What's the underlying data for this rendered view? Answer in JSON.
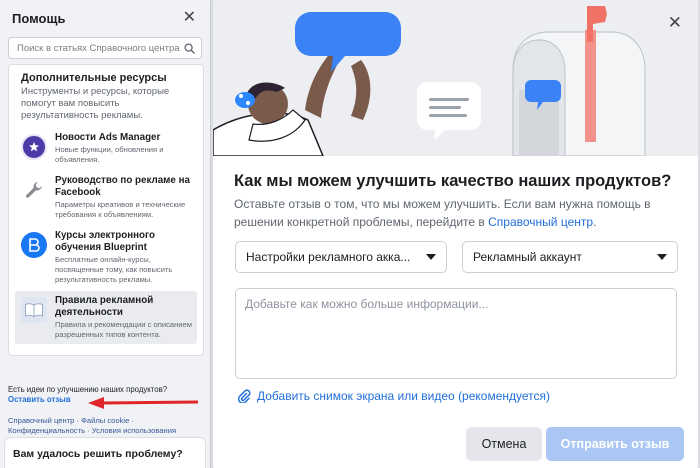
{
  "help": {
    "title": "Помощь",
    "close_icon": "close-icon",
    "search_placeholder": "Поиск в статьях Справочного центра",
    "resources_title": "Дополнительные ресурсы",
    "resources_subtitle": "Инструменты и ресурсы, которые помогут вам повысить результативность рекламы.",
    "items": [
      {
        "name": "Новости Ads Manager",
        "desc": "Новые функции, обновления и объявления.",
        "icon": "star-badge-icon",
        "color": "#4b3ba7"
      },
      {
        "name": "Руководство по рекламе на Facebook",
        "desc": "Параметры креативов и технические требования к объявлениям.",
        "icon": "wrench-icon",
        "color": "#8a8d91"
      },
      {
        "name": "Курсы электронного обучения Blueprint",
        "desc": "Бесплатные онлайн-курсы, посвященные тому, как повысить результативность рекламы.",
        "icon": "blueprint-icon",
        "color": "#1877f2"
      },
      {
        "name": "Правила рекламной деятельности",
        "desc": "Правила и рекомендации с описанием разрешенных типов контента.",
        "icon": "book-icon",
        "color": "#cfd8e6"
      }
    ],
    "feedback_prompt": "Есть идеи по улучшению наших продуктов?",
    "feedback_link": "Оставить отзыв",
    "footer_links": "Справочный центр · Файлы cookie · Конфиденциальность · Условия использования",
    "solved_question": "Вам удалось решить проблему?"
  },
  "modal": {
    "title": "Как мы можем улучшить качество наших продуктов?",
    "description_prefix": "Оставьте отзыв о том, что мы можем улучшить. Если вам нужна помощь в решении конкретной проблемы, перейдите в ",
    "description_link": "Справочный центр",
    "description_suffix": ".",
    "select_area": "Настройки рекламного акка...",
    "select_account": "Рекламный аккаунт",
    "textarea_placeholder": "Добавьте как можно больше информации...",
    "attach_label": "Добавить снимок экрана или видео (рекомендуется)",
    "cancel_label": "Отмена",
    "send_label": "Отправить отзыв"
  },
  "colors": {
    "accent": "#216fdb",
    "send_disabled": "#a9c7f2",
    "annotation_arrow": "#e0262b"
  }
}
